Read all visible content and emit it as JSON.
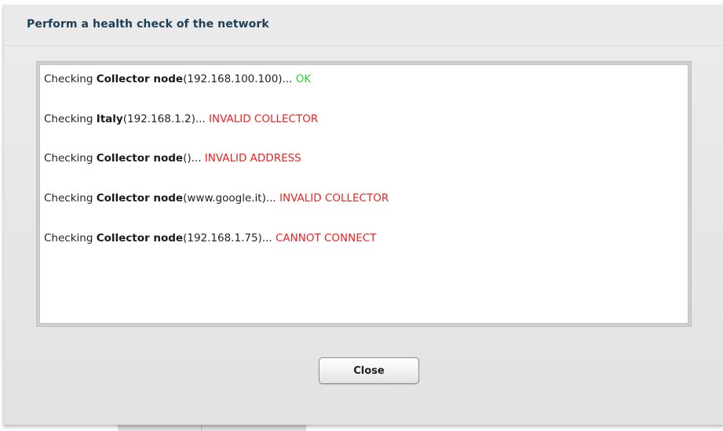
{
  "dialog": {
    "title": "Perform a health check of the network"
  },
  "log": {
    "lines": [
      {
        "prefix": "Checking ",
        "node": "Collector node",
        "address": "(192.168.100.100)... ",
        "status": "OK",
        "status_color": "#22dd22"
      },
      {
        "prefix": "Checking ",
        "node": "Italy",
        "address": "(192.168.1.2)... ",
        "status": "INVALID COLLECTOR",
        "status_color": "#ee2222"
      },
      {
        "prefix": "Checking ",
        "node": "Collector node",
        "address": "()... ",
        "status": "INVALID ADDRESS",
        "status_color": "#ee2222"
      },
      {
        "prefix": "Checking ",
        "node": "Collector node",
        "address": "(www.google.it)... ",
        "status": "INVALID COLLECTOR",
        "status_color": "#ee2222"
      },
      {
        "prefix": "Checking ",
        "node": "Collector node",
        "address": "(192.168.1.75)... ",
        "status": "CANNOT CONNECT",
        "status_color": "#ee2222"
      }
    ]
  },
  "actions": {
    "close_label": "Close"
  },
  "colors": {
    "title": "#1d3f57",
    "ok": "#22dd22",
    "error": "#ee2222"
  }
}
